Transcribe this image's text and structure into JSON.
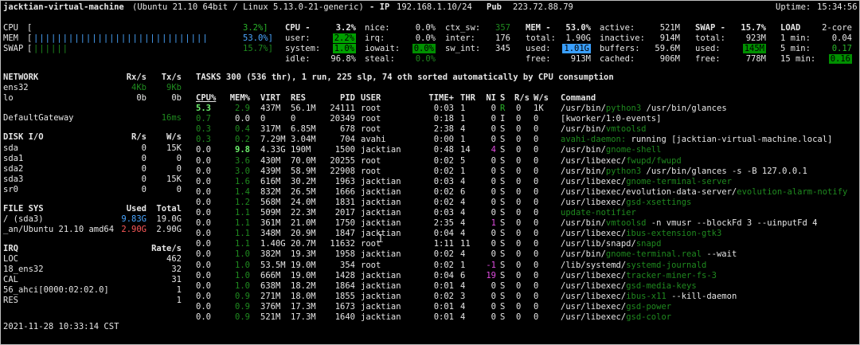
{
  "header": {
    "host": "jacktian-virtual-machine",
    "os": "(Ubuntu 21.10 64bit / Linux 5.13.0-21-generic)",
    "ip_label": "- IP",
    "ip": "192.168.1.10/24",
    "pub_label": "Pub",
    "pub_ip": "223.72.88.79",
    "uptime_label": "Uptime:",
    "uptime": "15:34:56"
  },
  "bars": [
    {
      "label": "CPU",
      "bar": "[",
      "ticks": "",
      "value": "3.2%]"
    },
    {
      "label": "MEM",
      "bar": "[",
      "ticks": "||||||||||||||||||||||||||||||",
      "value": "53.0%]"
    },
    {
      "label": "SWAP",
      "bar": "[",
      "ticks": "||||||",
      "value": "15.7%]"
    }
  ],
  "cpu": {
    "title": "CPU -",
    "total": "3.2%",
    "user_l": "user:",
    "user": "2.2%",
    "system_l": "system:",
    "system": "1.0%",
    "idle_l": "idle:",
    "idle": "96.8%",
    "nice_l": "nice:",
    "nice": "0.0%",
    "irq_l": "irq:",
    "irq": "0.0%",
    "iowait_l": "iowait:",
    "iowait": "0.0%",
    "steal_l": "steal:",
    "steal": "0.0%",
    "ctx_l": "ctx_sw:",
    "ctx": "357",
    "inter_l": "inter:",
    "inter": "176",
    "swint_l": "sw_int:",
    "swint": "345"
  },
  "mem": {
    "title": "MEM -",
    "pct": "53.0%",
    "total_l": "total:",
    "total": "1.90G",
    "used_l": "used:",
    "used": "1.01G",
    "free_l": "free:",
    "free": "913M",
    "active_l": "active:",
    "active": "521M",
    "inactive_l": "inactive:",
    "inactive": "914M",
    "buffers_l": "buffers:",
    "buffers": "59.6M",
    "cached_l": "cached:",
    "cached": "906M"
  },
  "swap": {
    "title": "SWAP -",
    "pct": "15.7%",
    "total_l": "total:",
    "total": "923M",
    "used_l": "used:",
    "used": "145M",
    "free_l": "free:",
    "free": "778M"
  },
  "load": {
    "title": "LOAD",
    "core": "2-core",
    "m1_l": "1 min:",
    "m1": "0.04",
    "m5_l": "5 min:",
    "m5": "0.17",
    "m15_l": "15 min:",
    "m15": "0.16"
  },
  "network": {
    "title": "NETWORK",
    "rx_h": "Rx/s",
    "tx_h": "Tx/s",
    "rows": [
      {
        "name": "ens32",
        "rx": "4Kb",
        "tx": "9Kb"
      },
      {
        "name": "lo",
        "rx": "0b",
        "tx": "0b"
      },
      {
        "name": "",
        "rx": "",
        "tx": ""
      },
      {
        "name": "DefaultGateway",
        "rx": "",
        "tx": "16ms"
      }
    ]
  },
  "disk": {
    "title": "DISK I/O",
    "r_h": "R/s",
    "w_h": "W/s",
    "rows": [
      {
        "name": "sda",
        "r": "0",
        "w": "15K"
      },
      {
        "name": "sda1",
        "r": "0",
        "w": "0"
      },
      {
        "name": "sda2",
        "r": "0",
        "w": "0"
      },
      {
        "name": "sda3",
        "r": "0",
        "w": "15K"
      },
      {
        "name": "sr0",
        "r": "0",
        "w": "0"
      }
    ]
  },
  "fs": {
    "title": "FILE SYS",
    "used_h": "Used",
    "total_h": "Total",
    "rows": [
      {
        "name": "/ (sda3)",
        "used": "9.83G",
        "total": "19.0G"
      },
      {
        "name": "_an/Ubuntu 21.10 amd64",
        "used": "2.90G",
        "total": "2.90G"
      }
    ]
  },
  "irq": {
    "title": "IRQ",
    "rate_h": "Rate/s",
    "rows": [
      {
        "name": "LOC",
        "rate": "462"
      },
      {
        "name": "18_ens32",
        "rate": "32"
      },
      {
        "name": "CAL",
        "rate": "31"
      },
      {
        "name": "56_ahci[0000:02:02.0]",
        "rate": "1"
      },
      {
        "name": "RES",
        "rate": "1"
      }
    ]
  },
  "tasks": {
    "summary": "TASKS 300 (536 thr), 1 run, 225 slp, 74 oth sorted automatically by CPU consumption",
    "headers": {
      "cpu": "CPU%",
      "mem": "MEM%",
      "virt": "VIRT",
      "res": "RES",
      "pid": "PID",
      "user": "USER",
      "time": "TIME+",
      "thr": "THR",
      "ni": "NI",
      "s": "S",
      "rs": "R/s",
      "ws": "W/s",
      "cmd": "Command"
    },
    "rows": [
      {
        "cpu": "5.3",
        "mem": "2.9",
        "virt": "437M",
        "res": "56.1M",
        "pid": "24111",
        "user": "root",
        "time": "0:03",
        "thr": "1",
        "ni": "0",
        "s": "R",
        "rs": "0",
        "ws": "1K",
        "cmd": "/usr/bin/",
        "cmd2": "python3",
        "cmd3": " /usr/bin/glances"
      },
      {
        "cpu": "0.7",
        "mem": "0.0",
        "virt": "0",
        "res": "0",
        "pid": "20349",
        "user": "root",
        "time": "0:18",
        "thr": "1",
        "ni": "0",
        "s": "I",
        "rs": "0",
        "ws": "0",
        "cmd": "[kworker/1:0-events]",
        "cmd2": "",
        "cmd3": ""
      },
      {
        "cpu": "0.3",
        "mem": "0.4",
        "virt": "317M",
        "res": "6.85M",
        "pid": "678",
        "user": "root",
        "time": "2:38",
        "thr": "4",
        "ni": "0",
        "s": "S",
        "rs": "0",
        "ws": "0",
        "cmd": "/usr/bin/",
        "cmd2": "vmtoolsd",
        "cmd3": ""
      },
      {
        "cpu": "0.3",
        "mem": "0.2",
        "virt": "7.29M",
        "res": "3.04M",
        "pid": "704",
        "user": "avahi",
        "time": "0:00",
        "thr": "1",
        "ni": "0",
        "s": "S",
        "rs": "0",
        "ws": "0",
        "cmd": "",
        "cmd2": "avahi-daemon:",
        "cmd3": " running [jacktian-virtual-machine.local]"
      },
      {
        "cpu": "0.0",
        "mem": "9.8",
        "virt": "4.33G",
        "res": "190M",
        "pid": "1500",
        "user": "jacktian",
        "time": "0:48",
        "thr": "14",
        "ni": "4",
        "s": "S",
        "rs": "0",
        "ws": "0",
        "cmd": "/usr/bin/",
        "cmd2": "gnome-shell",
        "cmd3": ""
      },
      {
        "cpu": "0.0",
        "mem": "3.6",
        "virt": "430M",
        "res": "70.0M",
        "pid": "20255",
        "user": "root",
        "time": "0:02",
        "thr": "5",
        "ni": "0",
        "s": "S",
        "rs": "0",
        "ws": "0",
        "cmd": "/usr/libexec/",
        "cmd2": "fwupd/fwupd",
        "cmd3": ""
      },
      {
        "cpu": "0.0",
        "mem": "3.0",
        "virt": "439M",
        "res": "58.9M",
        "pid": "22908",
        "user": "root",
        "time": "0:02",
        "thr": "1",
        "ni": "0",
        "s": "S",
        "rs": "0",
        "ws": "0",
        "cmd": "/usr/bin/",
        "cmd2": "python3",
        "cmd3": " /usr/bin/glances -s -B 127.0.0.1"
      },
      {
        "cpu": "0.0",
        "mem": "1.6",
        "virt": "616M",
        "res": "30.2M",
        "pid": "1963",
        "user": "jacktian",
        "time": "0:03",
        "thr": "4",
        "ni": "0",
        "s": "S",
        "rs": "0",
        "ws": "0",
        "cmd": "/usr/libexec/",
        "cmd2": "gnome-terminal-server",
        "cmd3": ""
      },
      {
        "cpu": "0.0",
        "mem": "1.4",
        "virt": "832M",
        "res": "26.5M",
        "pid": "1666",
        "user": "jacktian",
        "time": "0:02",
        "thr": "6",
        "ni": "0",
        "s": "S",
        "rs": "0",
        "ws": "0",
        "cmd": "/usr/libexec/evolution-data-server/",
        "cmd2": "evolution-alarm-notify",
        "cmd3": ""
      },
      {
        "cpu": "0.0",
        "mem": "1.2",
        "virt": "568M",
        "res": "24.0M",
        "pid": "1831",
        "user": "jacktian",
        "time": "0:02",
        "thr": "4",
        "ni": "0",
        "s": "S",
        "rs": "0",
        "ws": "0",
        "cmd": "/usr/libexec/",
        "cmd2": "gsd-xsettings",
        "cmd3": ""
      },
      {
        "cpu": "0.0",
        "mem": "1.1",
        "virt": "509M",
        "res": "22.3M",
        "pid": "2017",
        "user": "jacktian",
        "time": "0:03",
        "thr": "4",
        "ni": "0",
        "s": "S",
        "rs": "0",
        "ws": "0",
        "cmd": "",
        "cmd2": "update-notifier",
        "cmd3": ""
      },
      {
        "cpu": "0.0",
        "mem": "1.1",
        "virt": "361M",
        "res": "21.0M",
        "pid": "1750",
        "user": "jacktian",
        "time": "2:35",
        "thr": "4",
        "ni": "1",
        "s": "S",
        "rs": "0",
        "ws": "0",
        "cmd": "/usr/bin/",
        "cmd2": "vmtoolsd",
        "cmd3": " -n vmusr --blockFd 3 --uinputFd 4"
      },
      {
        "cpu": "0.0",
        "mem": "1.1",
        "virt": "348M",
        "res": "20.9M",
        "pid": "1847",
        "user": "jacktian",
        "time": "0:04",
        "thr": "4",
        "ni": "0",
        "s": "S",
        "rs": "0",
        "ws": "0",
        "cmd": "/usr/libexec/",
        "cmd2": "ibus-extension-gtk3",
        "cmd3": ""
      },
      {
        "cpu": "0.0",
        "mem": "1.1",
        "virt": "1.40G",
        "res": "20.7M",
        "pid": "11632",
        "user": "root",
        "time": "1:11",
        "thr": "11",
        "ni": "0",
        "s": "S",
        "rs": "0",
        "ws": "0",
        "cmd": "/usr/lib/snapd/",
        "cmd2": "snapd",
        "cmd3": ""
      },
      {
        "cpu": "0.0",
        "mem": "1.0",
        "virt": "382M",
        "res": "19.3M",
        "pid": "1958",
        "user": "jacktian",
        "time": "0:02",
        "thr": "4",
        "ni": "0",
        "s": "S",
        "rs": "0",
        "ws": "0",
        "cmd": "/usr/bin/",
        "cmd2": "gnome-terminal.real",
        "cmd3": " --wait"
      },
      {
        "cpu": "0.0",
        "mem": "1.0",
        "virt": "53.5M",
        "res": "19.0M",
        "pid": "354",
        "user": "root",
        "time": "0:02",
        "thr": "1",
        "ni": "-1",
        "s": "S",
        "rs": "0",
        "ws": "0",
        "cmd": "/lib/systemd/",
        "cmd2": "systemd-journald",
        "cmd3": ""
      },
      {
        "cpu": "0.0",
        "mem": "1.0",
        "virt": "666M",
        "res": "19.0M",
        "pid": "1428",
        "user": "jacktian",
        "time": "0:04",
        "thr": "6",
        "ni": "19",
        "s": "S",
        "rs": "0",
        "ws": "0",
        "cmd": "/usr/libexec/",
        "cmd2": "tracker-miner-fs-3",
        "cmd3": ""
      },
      {
        "cpu": "0.0",
        "mem": "1.0",
        "virt": "638M",
        "res": "18.2M",
        "pid": "1864",
        "user": "jacktian",
        "time": "0:01",
        "thr": "4",
        "ni": "0",
        "s": "S",
        "rs": "0",
        "ws": "0",
        "cmd": "/usr/libexec/",
        "cmd2": "gsd-media-keys",
        "cmd3": ""
      },
      {
        "cpu": "0.0",
        "mem": "0.9",
        "virt": "271M",
        "res": "18.0M",
        "pid": "1855",
        "user": "jacktian",
        "time": "0:02",
        "thr": "3",
        "ni": "0",
        "s": "S",
        "rs": "0",
        "ws": "0",
        "cmd": "/usr/libexec/",
        "cmd2": "ibus-x11",
        "cmd3": " --kill-daemon"
      },
      {
        "cpu": "0.0",
        "mem": "0.9",
        "virt": "376M",
        "res": "17.3M",
        "pid": "1673",
        "user": "jacktian",
        "time": "0:01",
        "thr": "4",
        "ni": "0",
        "s": "S",
        "rs": "0",
        "ws": "0",
        "cmd": "/usr/libexec/",
        "cmd2": "gsd-power",
        "cmd3": ""
      },
      {
        "cpu": "0.0",
        "mem": "0.9",
        "virt": "521M",
        "res": "17.3M",
        "pid": "1640",
        "user": "jacktian",
        "time": "0:01",
        "thr": "4",
        "ni": "0",
        "s": "S",
        "rs": "0",
        "ws": "0",
        "cmd": "/usr/libexec/",
        "cmd2": "gsd-color",
        "cmd3": ""
      }
    ]
  },
  "footer": {
    "datetime": "2021-11-28 10:33:14 CST"
  },
  "colors": {
    "background": "#000000",
    "text": "#e6e6e6",
    "ok": "#2ab52a",
    "dim": "#1f8a1f",
    "careful": "#4aa6ff",
    "warning": "#e04ce0",
    "critical": "#ff5a5a"
  }
}
